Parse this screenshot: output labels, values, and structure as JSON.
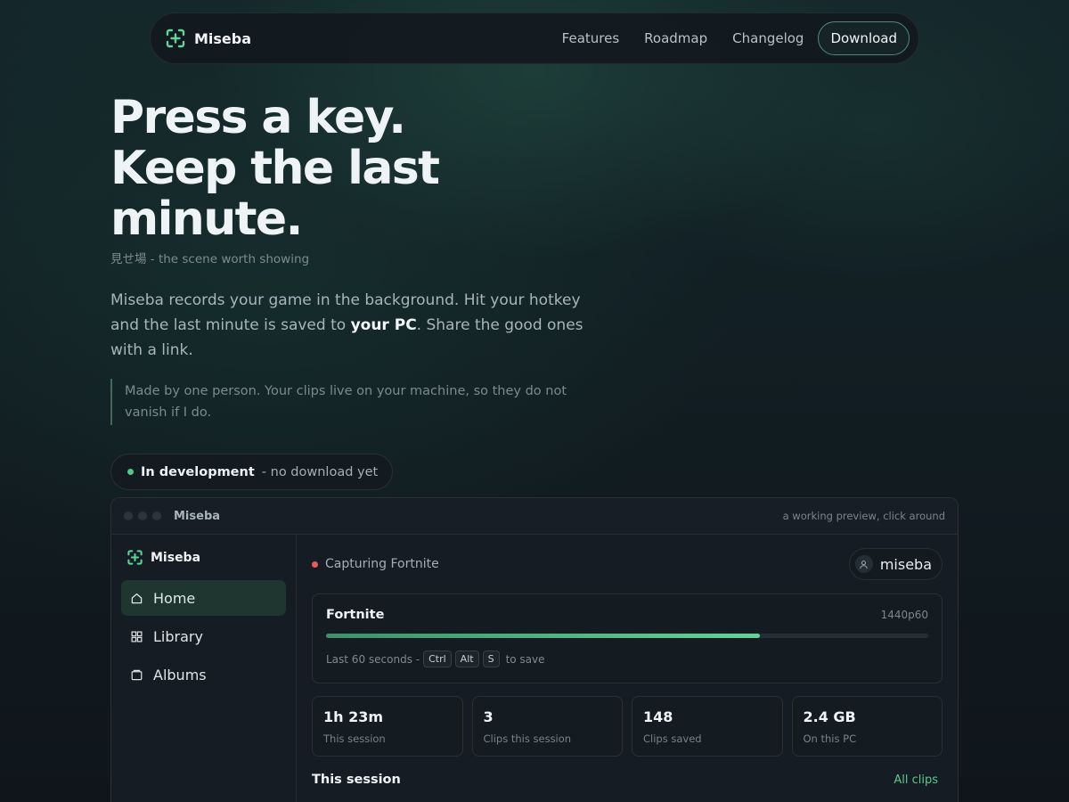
{
  "nav": {
    "brand": "Miseba",
    "links": [
      "Features",
      "Roadmap",
      "Changelog"
    ],
    "download": "Download"
  },
  "hero": {
    "title_line1": "Press a key.",
    "title_line2": "Keep the last minute.",
    "subtitle": "見せ場 - the scene worth showing",
    "lead_part1": "Miseba records your game in the background. Hit your hotkey and the last minute is saved to ",
    "lead_bold": "your PC",
    "lead_part2": ". Share the good ones with a link.",
    "quote": "Made by one person. Your clips live on your machine, so they do not vanish if I do.",
    "status_strong": "In development",
    "status_muted": "- no download yet"
  },
  "app": {
    "window_title": "Miseba",
    "window_hint": "a working preview, click around",
    "sidebar": {
      "brand": "Miseba",
      "items": [
        {
          "label": "Home",
          "icon": "home-icon"
        },
        {
          "label": "Library",
          "icon": "grid-icon"
        },
        {
          "label": "Albums",
          "icon": "album-icon"
        }
      ]
    },
    "capture_status": "Capturing Fortnite",
    "user": "miseba",
    "game": {
      "name": "Fortnite",
      "resolution": "1440p60",
      "buffer_fraction": 0.72,
      "hint_prefix": "Last 60 seconds -",
      "keys": [
        "Ctrl",
        "Alt",
        "S"
      ],
      "hint_suffix": "to save"
    },
    "stats": [
      {
        "value": "1h 23m",
        "label": "This session"
      },
      {
        "value": "3",
        "label": "Clips this session"
      },
      {
        "value": "148",
        "label": "Clips saved"
      },
      {
        "value": "2.4 GB",
        "label": "On this PC"
      }
    ],
    "section_title": "This session",
    "section_link": "All clips"
  },
  "colors": {
    "accent": "#55c98e",
    "recording": "#e35d5d"
  }
}
